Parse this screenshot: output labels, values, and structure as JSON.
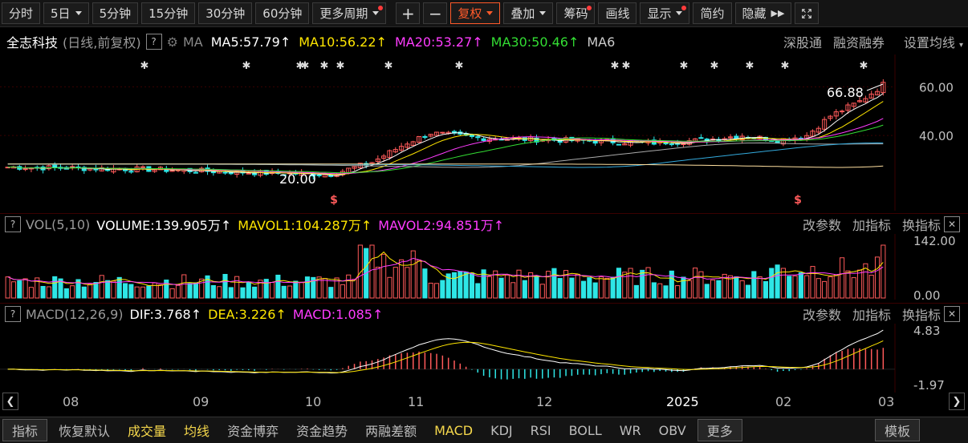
{
  "toolbar": {
    "items": [
      {
        "label": "分时",
        "dot": false,
        "caret": false
      },
      {
        "label": "5日",
        "dot": false,
        "caret": true
      },
      {
        "label": "5分钟",
        "dot": false,
        "caret": false
      },
      {
        "label": "15分钟",
        "dot": false,
        "caret": false
      },
      {
        "label": "30分钟",
        "dot": false,
        "caret": false
      },
      {
        "label": "60分钟",
        "dot": false,
        "caret": false
      },
      {
        "label": "更多周期",
        "dot": true,
        "caret": true
      }
    ],
    "plus": "+",
    "minus": "−",
    "fuquan": "复权",
    "diejia": "叠加",
    "chouma": "筹码",
    "huaxian": "画线",
    "xianshi": "显示",
    "jianyue": "简约",
    "yincang": "隐藏"
  },
  "header": {
    "name": "全志科技",
    "mode": "(日线,前复权)",
    "help": "?",
    "ma_label": "MA",
    "ma5": "MA5:57.79",
    "ma10": "MA10:56.22",
    "ma20": "MA20:53.27",
    "ma30": "MA30:50.46",
    "ma6": "MA6",
    "links": [
      "深股通",
      "融资融券",
      "设置均线"
    ],
    "high_label": "66.88",
    "low_label": "20.00",
    "price_axis": [
      "60.00",
      "40.00"
    ]
  },
  "vol": {
    "help": "?",
    "label": "VOL(5,10)",
    "volume": "VOLUME:139.905万",
    "mavol1": "MAVOL1:104.287万",
    "mavol2": "MAVOL2:94.851万",
    "axis": [
      "142.00",
      "0.00"
    ],
    "links": [
      "改参数",
      "加指标",
      "换指标"
    ],
    "close": "✕"
  },
  "macd": {
    "help": "?",
    "label": "MACD(12,26,9)",
    "dif": "DIF:3.768",
    "dea": "DEA:3.226",
    "macd": "MACD:1.085",
    "axis": [
      "4.83",
      "-1.97"
    ],
    "links": [
      "改参数",
      "加指标",
      "换指标"
    ],
    "close": "✕"
  },
  "dates": [
    "08",
    "09",
    "10",
    "11",
    "12",
    "2025",
    "02",
    "03"
  ],
  "bottom": [
    "指标",
    "恢复默认",
    "成交量",
    "均线",
    "资金博弈",
    "资金趋势",
    "两融差额",
    "MACD",
    "KDJ",
    "RSI",
    "BOLL",
    "WR",
    "OBV",
    "更多",
    "模板"
  ],
  "colors": {
    "up": "#ff5a5a",
    "down": "#2ee6e6",
    "ma5": "#ffffff",
    "ma10": "#ffe600",
    "ma20": "#ff3cff",
    "ma30": "#33dd33",
    "accent": "#ff5a2a"
  }
}
